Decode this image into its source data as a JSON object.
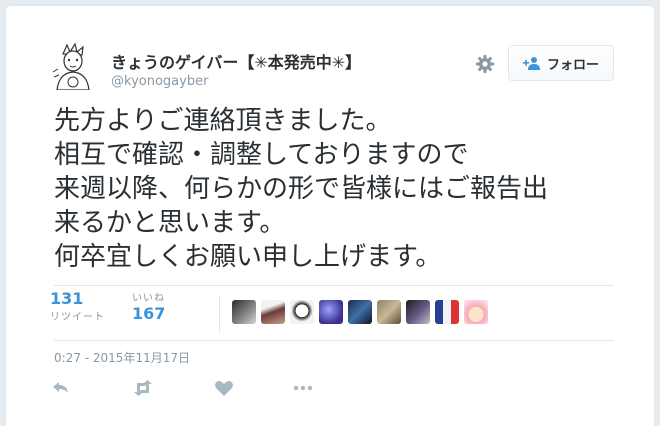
{
  "author": {
    "display_name": "きょうのゲイバー【✳︎本発売中✳︎】",
    "handle": "@kyonogayber"
  },
  "header": {
    "settings_icon": "gear-icon",
    "follow_label": "フォロー",
    "follow_icon": "add-user-icon"
  },
  "tweet": {
    "lines": [
      "先方よりご連絡頂きました。",
      "相互で確認・調整しておりますので",
      "来週以降、何らかの形で皆様にはご報告出",
      "来るかと思います。",
      "何卒宜しくお願い申し上げます。"
    ]
  },
  "stats": {
    "retweets": {
      "count": "131",
      "label": "リツイート"
    },
    "likes": {
      "count": "167",
      "label": "いいね"
    }
  },
  "likers_count_shown": 10,
  "timestamp": "0:27 - 2015年11月17日",
  "actions": [
    "reply-icon",
    "retweet-icon",
    "like-icon",
    "more-icon"
  ],
  "colors": {
    "link_blue": "#3b94d9",
    "text": "#292f33",
    "muted": "#8899a6",
    "icon_gray": "#aab8c2",
    "border": "#e1e8ed"
  }
}
